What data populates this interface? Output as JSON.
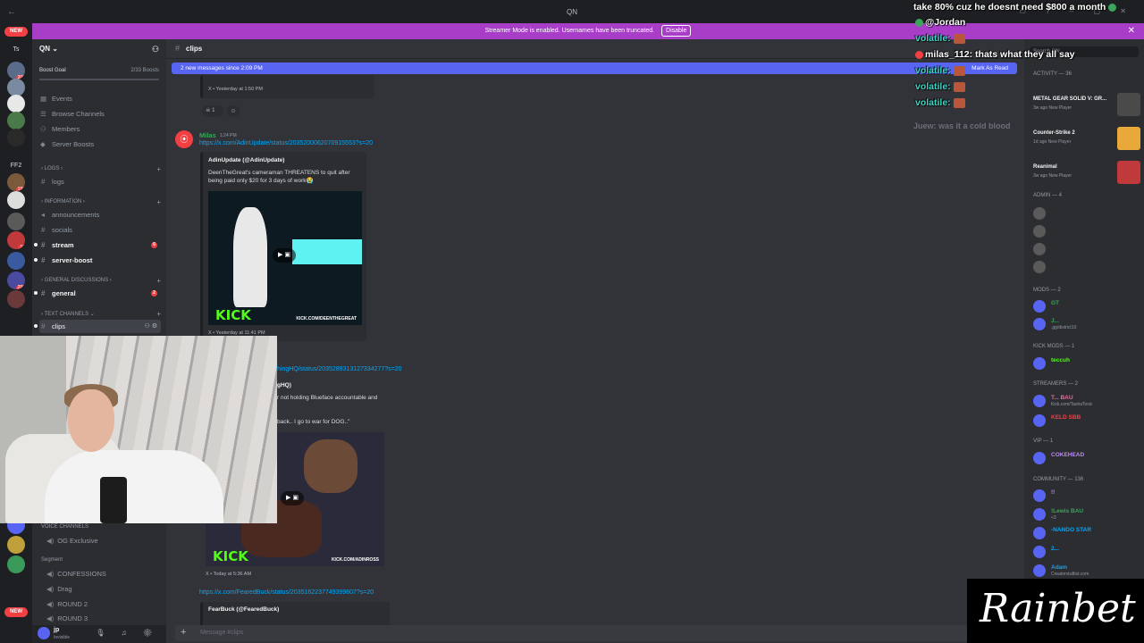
{
  "window": {
    "title": "QN"
  },
  "banner": {
    "text": "Streamer Mode is enabled. Usernames have been truncated.",
    "button": "Disable"
  },
  "servers": {
    "new_top": "NEW",
    "items": [
      {
        "label": "Ts",
        "badge": "",
        "color": "#1e1f22"
      },
      {
        "label": "",
        "badge": "200",
        "color": "#5b6b8a"
      },
      {
        "label": "",
        "badge": "",
        "color": "#7a8aa0"
      },
      {
        "label": "",
        "badge": "",
        "color": "#e8e8e8"
      },
      {
        "label": "",
        "badge": "",
        "color": "#4a7a4a"
      },
      {
        "label": "",
        "badge": "",
        "color": "#2a2a2a"
      },
      {
        "label": "FF2",
        "badge": "",
        "color": "#1e1f22"
      },
      {
        "label": "",
        "badge": "196",
        "color": "#7a5a3a"
      },
      {
        "label": "",
        "badge": "",
        "color": "#dddddd"
      },
      {
        "label": "",
        "badge": "",
        "color": "#5a5a5a"
      },
      {
        "label": "",
        "badge": "12",
        "color": "#c0393b"
      },
      {
        "label": "",
        "badge": "",
        "color": "#3a5aa0"
      },
      {
        "label": "",
        "badge": "290",
        "color": "#4a4aa0"
      },
      {
        "label": "",
        "badge": "",
        "color": "#6a3a3a"
      }
    ],
    "lower_items": [
      {
        "label": "",
        "badge": "284",
        "color": "#3a6a9a"
      },
      {
        "label": "",
        "badge": "",
        "color": "#5865f2"
      },
      {
        "label": "",
        "badge": "",
        "color": "#c0a03a"
      },
      {
        "label": "",
        "badge": "",
        "color": "#3a9a5a"
      }
    ],
    "new_bottom": "NEW"
  },
  "sidebar": {
    "server_name": "QN",
    "boost_goal": "Boost Goal",
    "boost_count": "2/33 Boosts",
    "nav": [
      "Events",
      "Browse Channels",
      "Members",
      "Server Boosts"
    ],
    "categories": {
      "logs": "LOGS",
      "information": "INFORMATION",
      "general_discussions": "GENERAL DISCUSSIONS",
      "text_channels": "TEXT CHANNELS",
      "voice_channels": "Voice Channels",
      "segment": "Segment"
    },
    "channels": {
      "logs": "logs",
      "announcements": "announcements",
      "socials": "socials",
      "stream": "stream",
      "stream_badge": "6",
      "server_boost": "server-boost",
      "general": "general",
      "general_badge": "2",
      "clips": "clips"
    },
    "voice": [
      "OG Exclusive",
      "CONFESSIONS",
      "Drag",
      "ROUND 2",
      "ROUND 3"
    ],
    "user": {
      "name": "jp",
      "status": "Invisible"
    }
  },
  "main": {
    "channel": "clips",
    "new_messages": "2 new messages since 2:09 PM",
    "mark_read": "Mark As Read",
    "first_footer": "X • Yesterday at 1:50 PM",
    "reaction_count": "1",
    "message": {
      "author": "Milas",
      "time": "1:24 PM",
      "link1": "https://x.com/AdinUpdate/status/2035200062070915553?s=20",
      "embed1_title": "AdinUpdate (@AdinUpdate)",
      "embed1_desc": "DeenTheGreat's cameraman THREATENS to quit after being paid only $20 for 3 days of work😭",
      "embed1_kick": "KICK",
      "embed1_kickurl": "KICK.COM/DEENTHEGREAT",
      "embed1_footer": "X • Yesterday at 11:41 PM",
      "link2": "hingHQ/status/2035289313127334277?s=20",
      "embed2_title": "gHQ)",
      "embed2_desc1": "r not holding Blueface accountable and",
      "embed2_desc2": "back.. I go to war for DOG..\"",
      "embed2_kick": "KICK",
      "embed2_kickurl": "KICK.COM/ADINROSS",
      "embed2_footer": "X • Today at 5:36 AM",
      "link3": "https://x.com/FearedBuck/status/2035162237749399607?s=20",
      "embed3_title": "FearBuck (@FearedBuck)"
    },
    "composer_placeholder": "Message #clips"
  },
  "members": {
    "search": "Search QN",
    "activity_header": "Activity — 36",
    "activities": [
      {
        "title": "METAL GEAR SOLID V: GR...",
        "sub": "3w ago  New Player",
        "color": "#4a4a4a"
      },
      {
        "title": "Counter-Strike 2",
        "sub": "1d ago  New Player",
        "color": "#e8a83a"
      },
      {
        "title": "Reanimal",
        "sub": "3w ago  New Player",
        "color": "#c0393b"
      }
    ],
    "admin_header": "Admin — 4",
    "mods_header": "Mods — 2",
    "mods": [
      {
        "name": "GT",
        "sub": "",
        "color": "#3ba55c"
      },
      {
        "name": "J...",
        "sub": ".gg/district10",
        "color": "#3ba55c"
      }
    ],
    "kickmods_header": "Kick Mods — 1",
    "kickmods": [
      {
        "name": "teccuh",
        "sub": "",
        "color": "#53fc18"
      }
    ],
    "streamers_header": "Streamers — 2",
    "streamers": [
      {
        "name": "T...  BAU",
        "sub": "Kick.com/TashaTosic",
        "color": "#e06c9f"
      },
      {
        "name": "KELD  SBB",
        "sub": "",
        "color": "#f23f43"
      }
    ],
    "vip_header": "VIP — 1",
    "vip": [
      {
        "name": "COKEHEAD",
        "sub": "",
        "color": "#b98cf4"
      }
    ],
    "community_header": "Community — 136",
    "community": [
      {
        "name": "!!",
        "sub": "",
        "color": "#b98cf4"
      },
      {
        "name": "!Lewis  BAU",
        "sub": "<3",
        "color": "#3ba55c"
      },
      {
        "name": "-NANDO  STAR",
        "sub": "",
        "color": "#00a8fc"
      },
      {
        "name": "2...",
        "sub": "",
        "color": "#00a8fc"
      },
      {
        "name": "Adam",
        "sub": "Creatorvisitlist.com",
        "color": "#00a8fc"
      }
    ]
  },
  "overlay_chat": [
    {
      "user": "",
      "text": "take 80% cuz he doesnt need $800 a month"
    },
    {
      "user": "",
      "text": "@Jordan"
    },
    {
      "user": "volatile:",
      "text": ""
    },
    {
      "user": "milas_112:",
      "text": " thats what they all say"
    },
    {
      "user": "volatile:",
      "text": ""
    },
    {
      "user": "volatile:",
      "text": ""
    },
    {
      "user": "volatile:",
      "text": ""
    }
  ],
  "overlay_faded": "Juew:  was it a cold blood",
  "sponsor": "Rainbet"
}
